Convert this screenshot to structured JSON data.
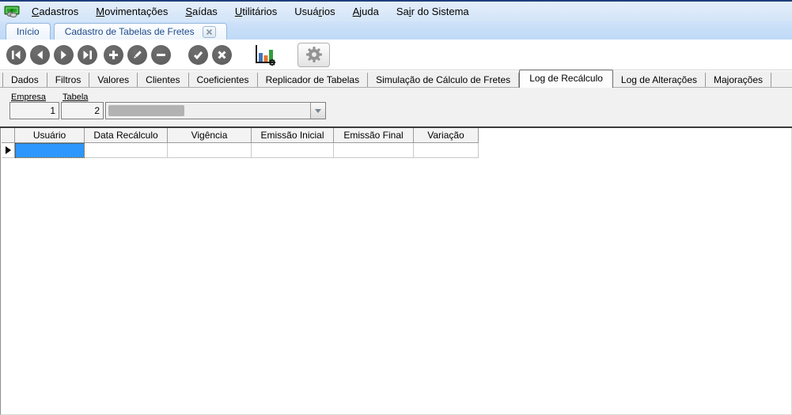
{
  "menubar": {
    "items": [
      {
        "pre": "",
        "key": "C",
        "post": "adastros"
      },
      {
        "pre": "",
        "key": "M",
        "post": "ovimentações"
      },
      {
        "pre": "",
        "key": "S",
        "post": "aídas"
      },
      {
        "pre": "",
        "key": "U",
        "post": "tilitários"
      },
      {
        "pre": "Usuá",
        "key": "r",
        "post": "ios"
      },
      {
        "pre": "",
        "key": "A",
        "post": "juda"
      },
      {
        "pre": "Sa",
        "key": "i",
        "post": "r do Sistema"
      }
    ]
  },
  "document_tabs": {
    "tabs": [
      {
        "label": "Início"
      },
      {
        "label": "Cadastro de Tabelas de Fretes",
        "close_icon": "close-tab-icon"
      }
    ]
  },
  "toolbar": {
    "buttons": [
      "first-record-icon",
      "prior-record-icon",
      "next-record-icon",
      "last-record-icon",
      "insert-record-icon",
      "edit-record-icon",
      "delete-record-icon",
      "confirm-icon",
      "cancel-icon",
      "chart-icon",
      "settings-gear-icon"
    ]
  },
  "page_tabs": {
    "items": [
      "Dados",
      "Filtros",
      "Valores",
      "Clientes",
      "Coeficientes",
      "Replicador de Tabelas",
      "Simulação de Cálculo de Fretes",
      "Log de Recálculo",
      "Log de Alterações",
      "Majorações"
    ],
    "active": "Log de Recálculo"
  },
  "filters": {
    "empresa": {
      "label": "Empresa",
      "value": "1"
    },
    "tabela": {
      "label": "Tabela",
      "value": "2"
    },
    "tabela_combo": {
      "value": "",
      "note": "redacted-gray-block"
    }
  },
  "grid": {
    "columns": [
      "Usuário",
      "Data Recálculo",
      "Vigência",
      "Emissão Inicial",
      "Emissão Final",
      "Variação"
    ],
    "rows": [
      {
        "cells": [
          "",
          "",
          "",
          "",
          "",
          ""
        ],
        "selected_cell_index": 0,
        "row_indicator": "current-row-arrow"
      }
    ]
  },
  "colors": {
    "selection_blue": "#2E97FD",
    "menubar_top_line": "#1E3F7D",
    "menubar_bg": "#D9E8F9",
    "doc_tab_strip_bg": "#C6DDF8",
    "panel_bg": "#F1F1F1",
    "dark_separator": "#3B3B3B",
    "toolbar_button_gray": "#616161",
    "chart_bar_blue": "#4273B8",
    "chart_bar_orange": "#E0762F",
    "chart_bar_green": "#2F9E3F"
  }
}
